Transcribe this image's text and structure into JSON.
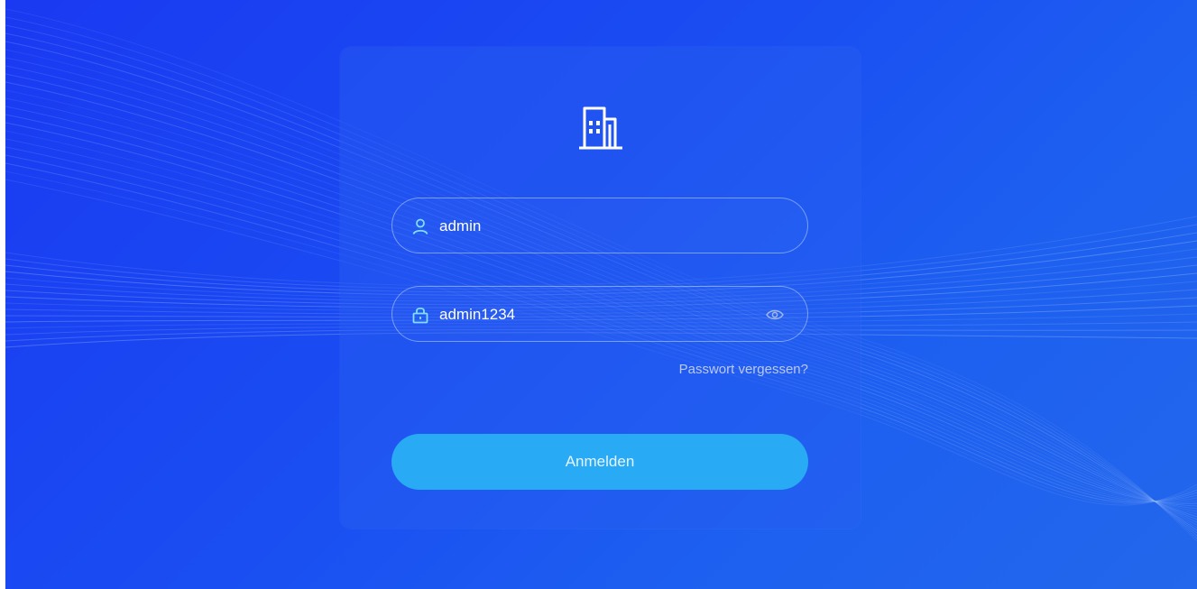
{
  "theme": {
    "background_start": "#1a39f2",
    "background_end": "#2367ec",
    "card_background": "rgba(40,95,240,0.42)",
    "field_border": "#bed7ff",
    "button_color": "#29aaf4",
    "icon_color": "#ffffff"
  },
  "logo": {
    "icon": "building-icon"
  },
  "login_form": {
    "username": {
      "icon": "user-icon",
      "value": "admin"
    },
    "password": {
      "icon": "lock-icon",
      "value": "admin1234",
      "toggle_icon": "eye-icon"
    },
    "forgot_password_label": "Passwort vergessen?",
    "submit_label": "Anmelden"
  }
}
